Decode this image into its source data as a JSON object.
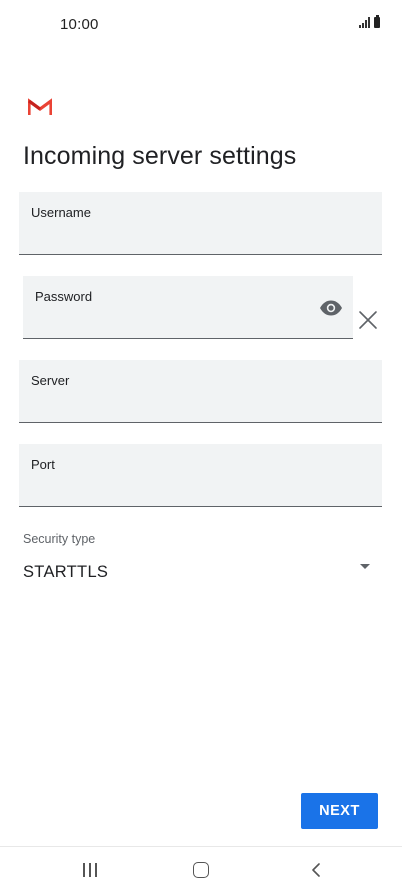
{
  "status_bar": {
    "time": "10:00"
  },
  "header": {
    "title": "Incoming server settings"
  },
  "form": {
    "username": {
      "label": "Username",
      "value": ""
    },
    "password": {
      "label": "Password",
      "value": ""
    },
    "server": {
      "label": "Server",
      "value": ""
    },
    "port": {
      "label": "Port",
      "value": ""
    },
    "security": {
      "label": "Security type",
      "value": "STARTTLS"
    }
  },
  "actions": {
    "next_label": "NEXT"
  },
  "icons": {
    "logo": "gmail-icon",
    "password_toggle": "eye-icon",
    "clear": "close-icon",
    "dropdown": "dropdown-arrow-icon",
    "nav_recents": "recent-apps-icon",
    "nav_home": "home-icon",
    "nav_back": "back-icon"
  },
  "colors": {
    "accent": "#1a73e8",
    "gmail_red": "#ea4335",
    "field_bg": "#f1f3f4"
  }
}
